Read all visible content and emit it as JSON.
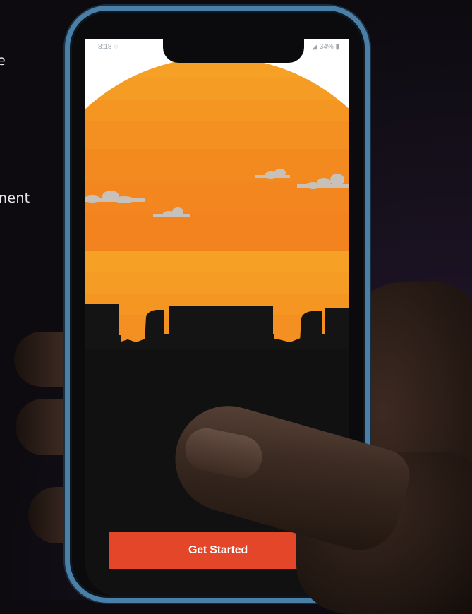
{
  "side_text": {
    "line1": "e",
    "line2": "nent"
  },
  "status_bar": {
    "left": "8:18 ◌",
    "right": "◢ 34% ▮"
  },
  "screen": {
    "get_started_label": "Get Started"
  },
  "colors": {
    "sun": "#f4911f",
    "button": "#e4462a",
    "frame": "#4a7fa8",
    "ground": "#111111"
  },
  "icons": [
    "cloud-icon",
    "truck-icon"
  ]
}
